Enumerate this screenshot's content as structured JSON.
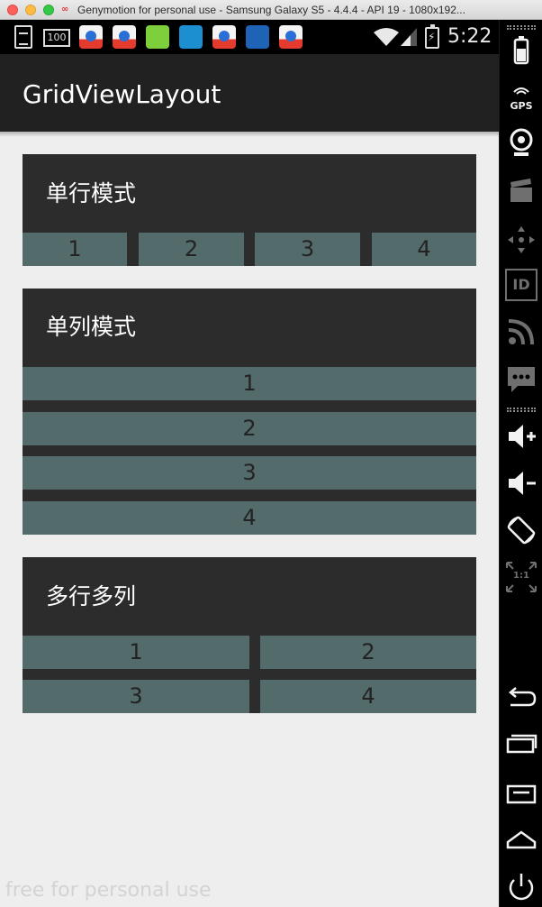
{
  "window": {
    "title": "Genymotion for personal use - Samsung Galaxy S5 - 4.4.4 - API 19 - 1080x192..."
  },
  "status_bar": {
    "badge_text": "100",
    "time": "5:22"
  },
  "app": {
    "title": "GridViewLayout"
  },
  "cards": [
    {
      "title": "单行模式",
      "cells": [
        "1",
        "2",
        "3",
        "4"
      ]
    },
    {
      "title": "单列模式",
      "cells": [
        "1",
        "2",
        "3",
        "4"
      ]
    },
    {
      "title": "多行多列",
      "cells": [
        "1",
        "2",
        "3",
        "4"
      ]
    }
  ],
  "side_panel": {
    "gps_label": "GPS",
    "id_label": "ID",
    "pixel_label": "1:1"
  },
  "watermark": "free for personal use",
  "colors": {
    "action_bar": "#212121",
    "card_background": "#2c2c2c",
    "cell_background": "#536b6a",
    "content_background": "#eeeeee"
  }
}
